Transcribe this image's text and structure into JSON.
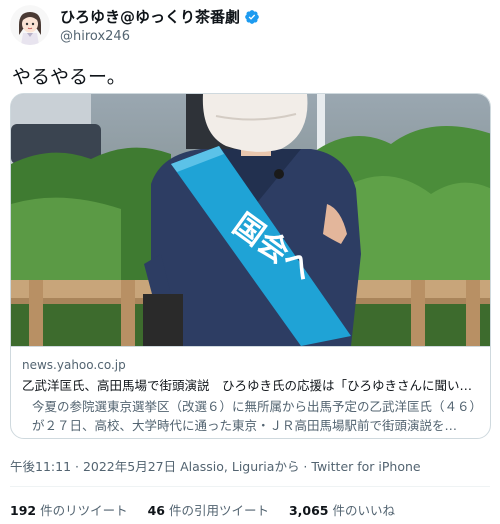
{
  "author": {
    "display_name": "ひろゆき@ゆっくり茶番劇",
    "handle": "@hirox246",
    "verified_icon": "verified-badge-icon"
  },
  "tweet": {
    "text": "やるやるー。"
  },
  "card": {
    "domain": "news.yahoo.co.jp",
    "title": "乙武洋匡氏、高田馬場で街頭演説　ひろゆき氏の応援は「ひろゆきさんに聞い…",
    "description": "今夏の参院選東京選挙区（改選６）に無所属から出馬予定の乙武洋匡氏（４６）が２７日、高校、大学時代に通った東京・ＪＲ高田馬場駅前で街頭演説を…",
    "image_sash_text": "国会へ"
  },
  "meta": {
    "time": "午後11:11",
    "sep1": " · ",
    "date": "2022年5月27日",
    "location": " Alassio, Liguriaから",
    "sep2": " · ",
    "source": "Twitter for iPhone"
  },
  "stats": {
    "retweets_count": "192",
    "retweets_label": " 件のリツイート",
    "quotes_count": "46",
    "quotes_label": " 件の引用ツイート",
    "likes_count": "3,065",
    "likes_label": " 件のいいね"
  },
  "colors": {
    "verified": "#1d9bf0",
    "sash": "#1fa3d6",
    "shirt": "#2d3d63",
    "hedge": "#4b8d3a"
  }
}
